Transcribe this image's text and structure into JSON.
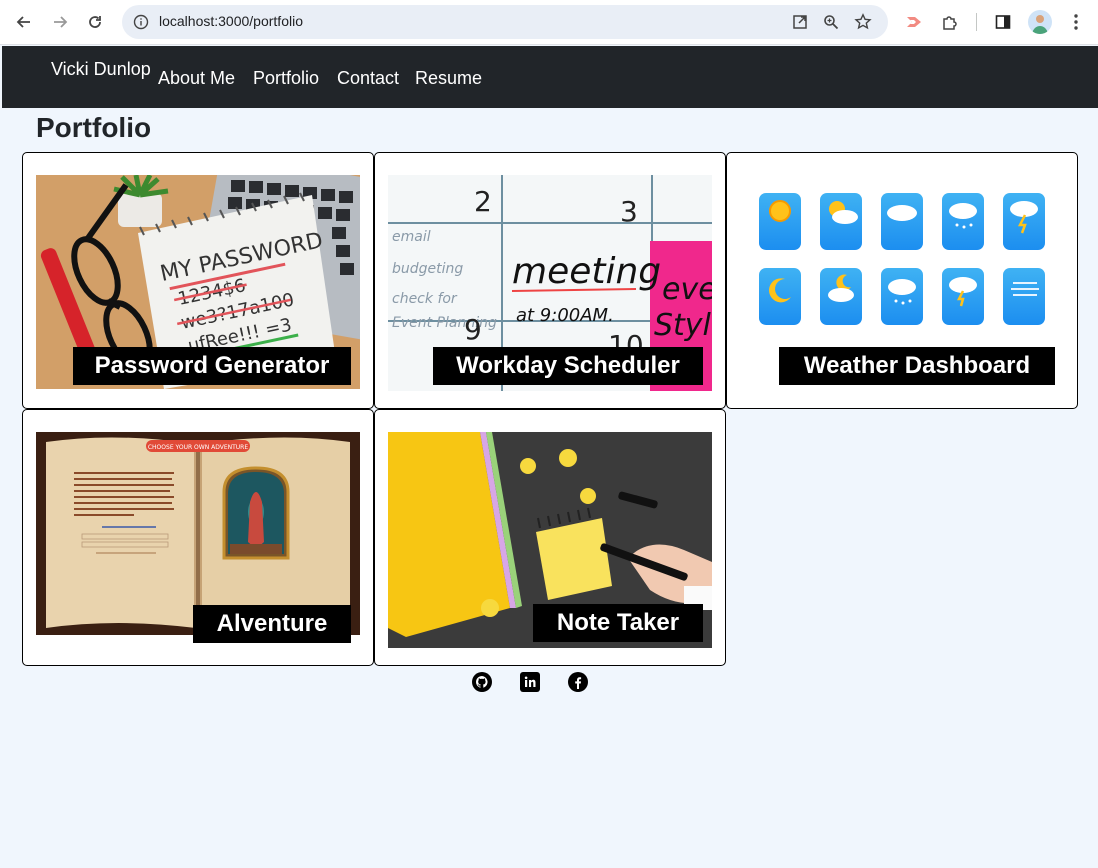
{
  "browser": {
    "url": "localhost:3000/portfolio"
  },
  "site": {
    "brand": "Vicki Dunlop",
    "nav": [
      "About Me",
      "Portfolio",
      "Contact",
      "Resume"
    ]
  },
  "page": {
    "title": "Portfolio"
  },
  "projects": [
    {
      "title": "Password Generator",
      "notepad_lines": [
        "MY PASSWORD",
        "1234$6",
        "we3?17a100",
        "ufRee!!! =3"
      ]
    },
    {
      "title": "Workday Scheduler",
      "calendar": {
        "day_left": "2",
        "day_right": "3",
        "word": "meeting",
        "time": "at 9:00AM.",
        "left_notes": [
          "email",
          "budgeting",
          "check for",
          "Event Planning"
        ],
        "left_day2": "9",
        "right_day2": "10",
        "pink": [
          "even",
          "Styli"
        ]
      }
    },
    {
      "title": "Weather Dashboard"
    },
    {
      "title": "Alventure",
      "book_banner": "CHOOSE YOUR OWN ADVENTURE"
    },
    {
      "title": "Note Taker"
    }
  ],
  "socials": [
    "github-icon",
    "linkedin-icon",
    "facebook-icon"
  ],
  "colors": {
    "navbar": "#212529",
    "page_bg": "#f0f6fd",
    "caption_bg": "#000000"
  }
}
